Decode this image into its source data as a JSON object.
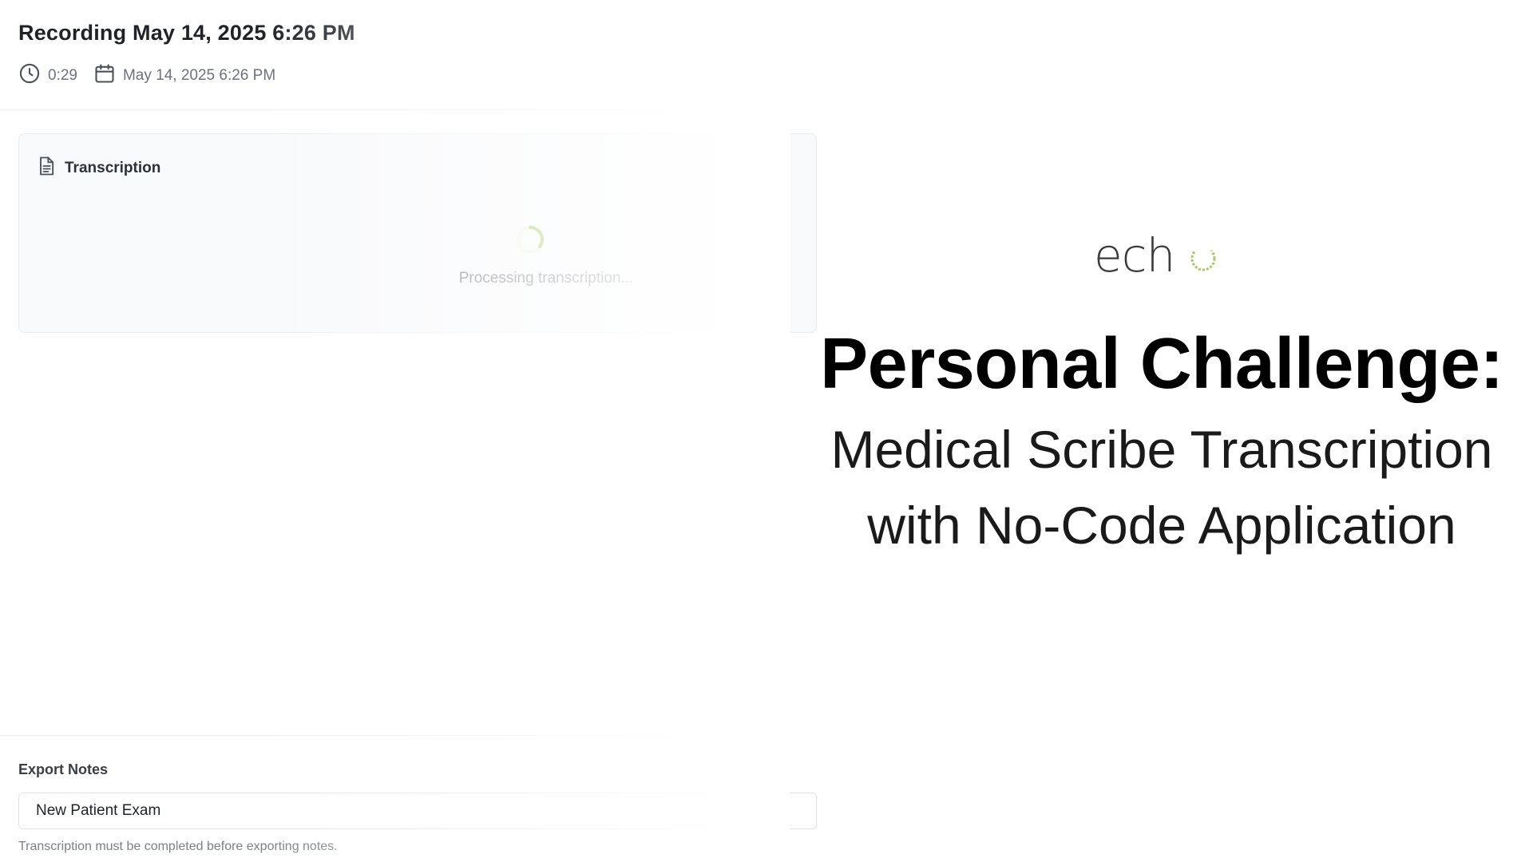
{
  "recording": {
    "title": "Recording May 14, 2025 6:26 PM",
    "duration": "0:29",
    "date": "May 14, 2025 6:26 PM"
  },
  "transcription": {
    "heading": "Transcription",
    "status": "Processing transcription..."
  },
  "export": {
    "label": "Export Notes",
    "selected_template": "New Patient Exam",
    "hint": "Transcription must be completed before exporting notes."
  },
  "slide": {
    "logo_text": "ech",
    "headline": "Personal Challenge:",
    "subtitle_line1": "Medical Scribe Transcription",
    "subtitle_line2": "with No-Code Application"
  },
  "icons": {
    "duration": "clock-icon",
    "date": "calendar-icon",
    "transcription": "document-icon",
    "loading": "spinner-icon"
  },
  "colors": {
    "accent_green": "#a6c95f",
    "text_muted": "#6b7280",
    "card_background": "#f8f9fb"
  }
}
